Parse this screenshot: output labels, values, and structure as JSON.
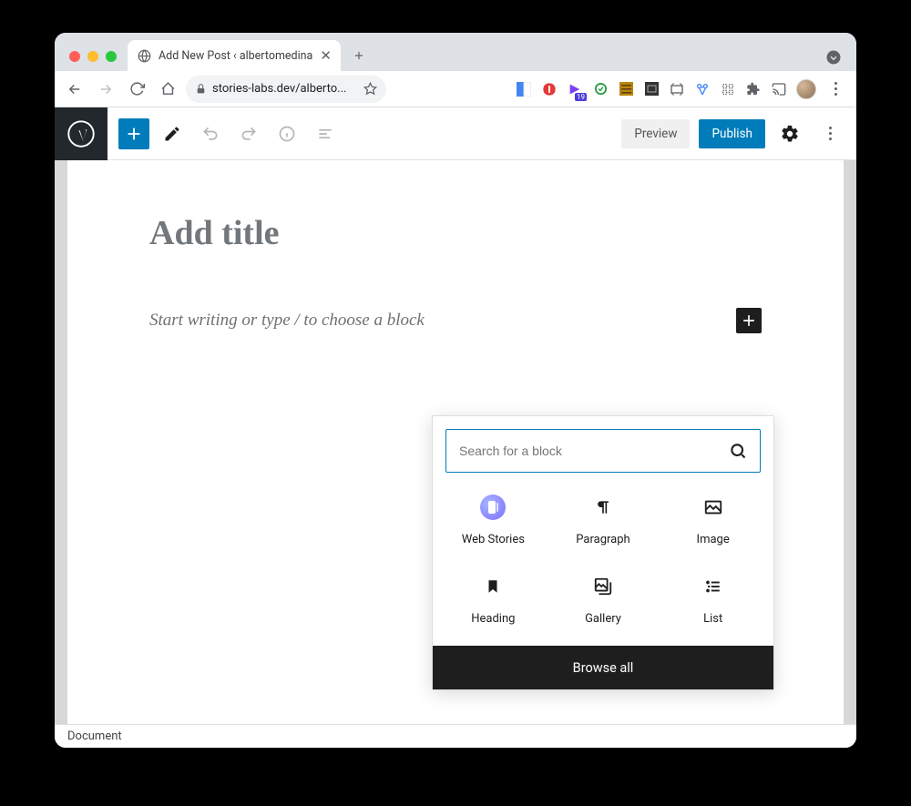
{
  "browser": {
    "tab_title": "Add New Post ‹ albertomedina",
    "url_display": "stories-labs.dev/alberto...",
    "ext_badge": "19"
  },
  "editor": {
    "preview_label": "Preview",
    "publish_label": "Publish",
    "title_placeholder": "Add title",
    "body_placeholder": "Start writing or type / to choose a block",
    "footer_label": "Document"
  },
  "inserter": {
    "search_placeholder": "Search for a block",
    "browse_all_label": "Browse all",
    "blocks": [
      {
        "label": "Web Stories"
      },
      {
        "label": "Paragraph"
      },
      {
        "label": "Image"
      },
      {
        "label": "Heading"
      },
      {
        "label": "Gallery"
      },
      {
        "label": "List"
      }
    ]
  }
}
